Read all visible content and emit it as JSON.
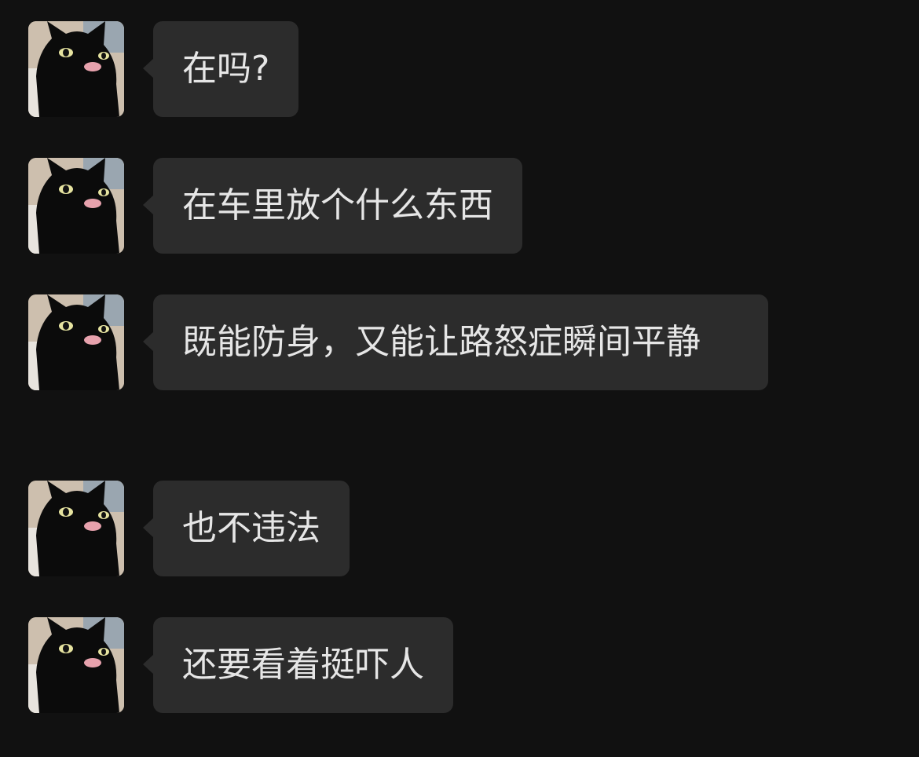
{
  "theme": {
    "background": "#111111",
    "bubble_color": "#2c2c2c",
    "text_color": "#e6e6e6"
  },
  "messages": [
    {
      "sender_avatar": "black-cat-avatar",
      "text": "在吗?"
    },
    {
      "sender_avatar": "black-cat-avatar",
      "text": "在车里放个什么东西"
    },
    {
      "sender_avatar": "black-cat-avatar",
      "text": "既能防身，又能让路怒症瞬间平静"
    },
    {
      "sender_avatar": "black-cat-avatar",
      "text": "也不违法"
    },
    {
      "sender_avatar": "black-cat-avatar",
      "text": "还要看着挺吓人"
    }
  ]
}
